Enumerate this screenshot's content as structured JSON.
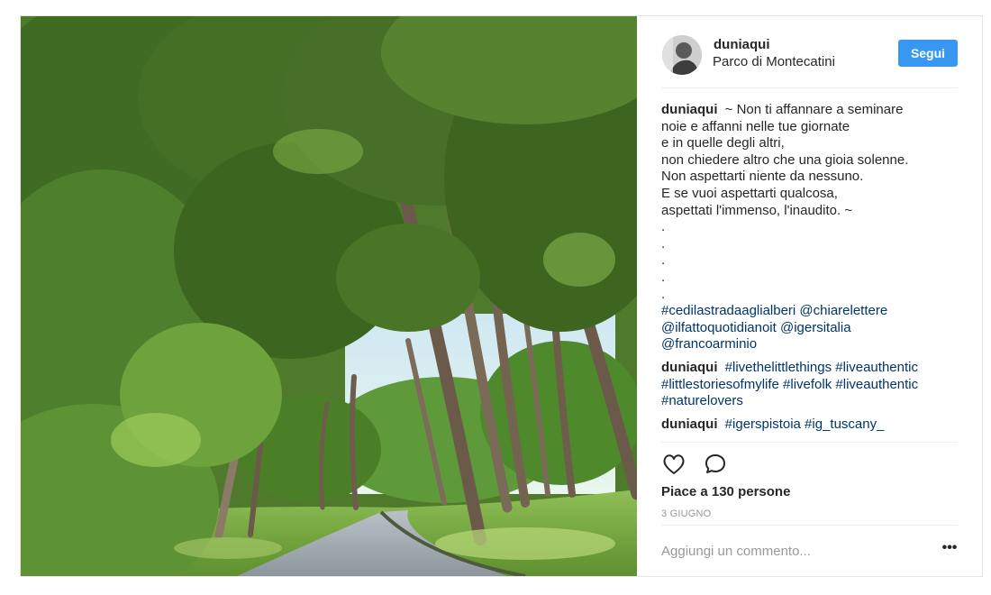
{
  "post": {
    "username": "duniaqui",
    "location": "Parco di Montecatini",
    "follow_label": "Segui",
    "caption_author": "duniaqui",
    "caption_lines": [
      "~ Non ti affannare a seminare",
      "noie e affanni nelle tue giornate",
      "e in quelle degli altri,",
      "non chiedere altro che una gioia solenne.",
      "Non aspettarti niente da nessuno.",
      "E se vuoi aspettarti qualcosa,",
      "aspettati l'immenso, l'inaudito. ~",
      ".",
      ".",
      ".",
      ".",
      "."
    ],
    "caption_tags": [
      "#cedilastradaaglialberi @chiarelettere",
      "@ilfattoquotidianoit @igersitalia",
      "@francoarminio"
    ],
    "comments": [
      {
        "author": "duniaqui",
        "lines": [
          "#livethelittlethings #liveauthentic",
          "#littlestoriesofmylife #livefolk #liveauthentic",
          "#naturelovers"
        ]
      },
      {
        "author": "duniaqui",
        "lines": [
          "#igerspistoia #ig_tuscany_"
        ]
      }
    ],
    "likes_text": "Piace a 130 persone",
    "date": "3 GIUGNO",
    "comment_placeholder": "Aggiungi un commento...",
    "more_label": "•••"
  },
  "icons": {
    "like": "heart-icon",
    "comment": "speech-bubble-icon",
    "more": "more-options-icon"
  },
  "colors": {
    "follow_button": "#3897f0",
    "hashtag": "#003569",
    "muted": "#999999",
    "text": "#262626"
  }
}
